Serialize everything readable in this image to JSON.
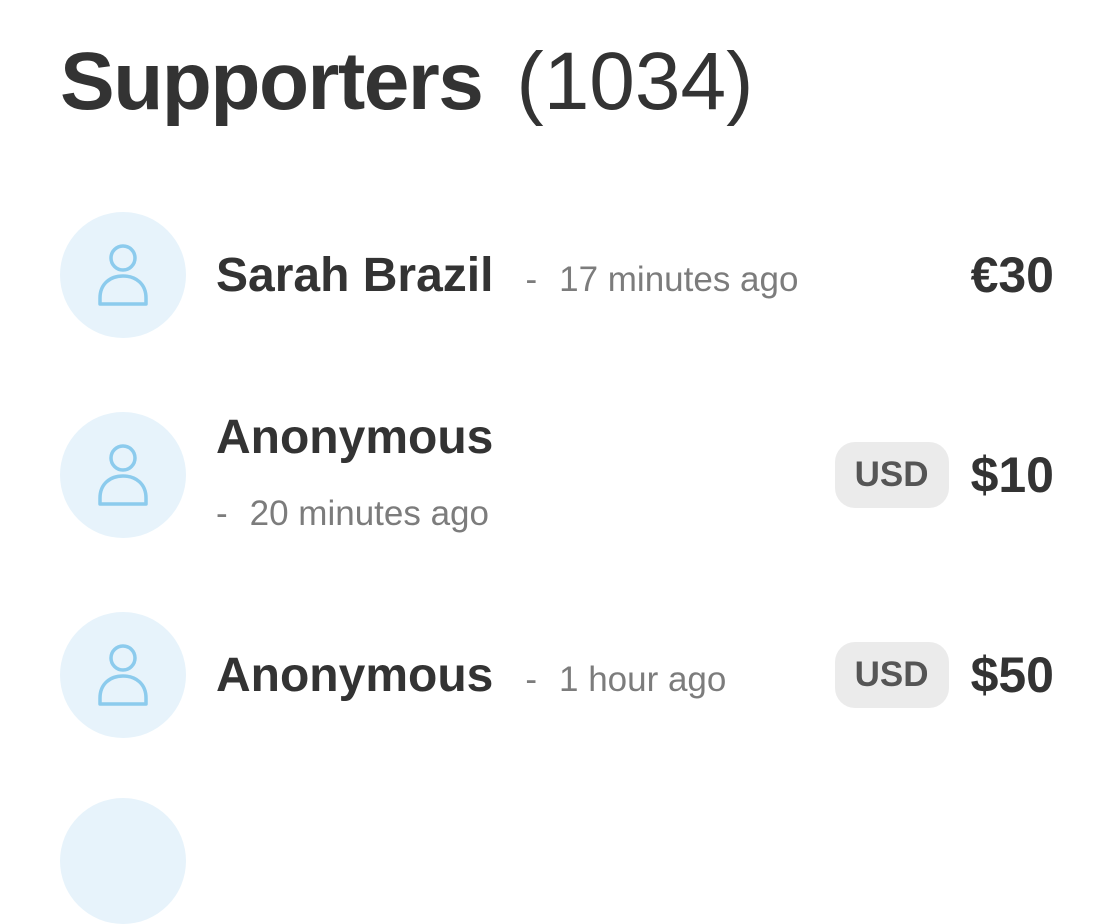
{
  "header": {
    "title": "Supporters",
    "count": "(1034)"
  },
  "supporters": [
    {
      "name": "Sarah Brazil",
      "dash": "-",
      "time": "17 minutes ago",
      "currency": "",
      "amount": "€30",
      "icon": "user-icon"
    },
    {
      "name": "Anonymous",
      "dash": "-",
      "time": "20 minutes ago",
      "currency": "USD",
      "amount": "$10",
      "icon": "user-icon"
    },
    {
      "name": "Anonymous",
      "dash": "-",
      "time": "1 hour ago",
      "currency": "USD",
      "amount": "$50",
      "icon": "user-icon"
    }
  ],
  "colors": {
    "text": "#333333",
    "muted": "#7c7c7c",
    "avatar_bg": "#e7f3fb",
    "avatar_icon": "#8ccbed",
    "badge_bg": "#ebebeb"
  }
}
